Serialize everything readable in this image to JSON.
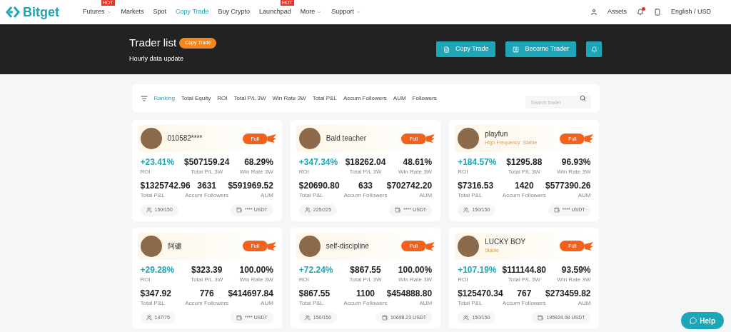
{
  "logo": {
    "text": "Bitget"
  },
  "nav": [
    {
      "label": "Futures",
      "selected": false,
      "badge": "HOT",
      "dropdown": true
    },
    {
      "label": "Markets",
      "selected": false,
      "dropdown": false
    },
    {
      "label": "Spot",
      "selected": false,
      "dropdown": false
    },
    {
      "label": "Copy Trade",
      "selected": true,
      "dropdown": false
    },
    {
      "label": "Buy Crypto",
      "selected": false,
      "dropdown": false
    },
    {
      "label": "Launchpad",
      "selected": false,
      "badge": "HOT",
      "dropdown": false
    },
    {
      "label": "More",
      "selected": false,
      "dropdown": true
    },
    {
      "label": "Support",
      "selected": false,
      "dropdown": true
    }
  ],
  "header_right": {
    "assets": "Assets",
    "notification_dot": true,
    "language": "English / USD"
  },
  "banner": {
    "title": "Trader list",
    "tag": "Copy Trade",
    "subtitle": "Hourly data update",
    "buttons": [
      "Copy Trade",
      "Become Trader"
    ]
  },
  "filters": [
    {
      "label": "Ranking",
      "selected": true
    },
    {
      "label": "Total Equity",
      "selected": false
    },
    {
      "label": "ROI",
      "selected": false
    },
    {
      "label": "Total P/L 3W",
      "selected": false
    },
    {
      "label": "Win Rate 3W",
      "selected": false
    },
    {
      "label": "Total P&L",
      "selected": false
    },
    {
      "label": "Accum Followers",
      "selected": false
    },
    {
      "label": "AUM",
      "selected": false
    },
    {
      "label": "Followers",
      "selected": false
    }
  ],
  "search": {
    "placeholder": "Search trader"
  },
  "traders": [
    {
      "name": "010582****",
      "status": "Full",
      "stats": [
        {
          "value": "+23.41%",
          "label": "ROI"
        },
        {
          "value": "$507159.24",
          "label": "Total P/L 3W"
        },
        {
          "value": "68.29%",
          "label": "Win Rate 3W"
        },
        {
          "value": "$1325742.96",
          "label": "Total P&L"
        },
        {
          "value": "3631",
          "label": "Accum Followers"
        },
        {
          "value": "$591969.52",
          "label": "AUM"
        }
      ],
      "followers": "150/150",
      "funds": "**** USDT"
    },
    {
      "name": "Bald teacher",
      "status": "Full",
      "stats": [
        {
          "value": "+347.34%",
          "label": "ROI"
        },
        {
          "value": "$18262.04",
          "label": "Total P/L 3W"
        },
        {
          "value": "48.61%",
          "label": "Win Rate 3W"
        },
        {
          "value": "$20690.80",
          "label": "Total P&L"
        },
        {
          "value": "633",
          "label": "Accum Followers"
        },
        {
          "value": "$702742.20",
          "label": "AUM"
        }
      ],
      "followers": "225/225",
      "funds": "**** USDT"
    },
    {
      "name": "playfun",
      "tags": "High Frequency  Stable",
      "status": "Full",
      "stats": [
        {
          "value": "+184.57%",
          "label": "ROI"
        },
        {
          "value": "$1295.88",
          "label": "Total P/L 3W"
        },
        {
          "value": "96.93%",
          "label": "Win Rate 3W"
        },
        {
          "value": "$7316.53",
          "label": "Total P&L"
        },
        {
          "value": "1420",
          "label": "Accum Followers"
        },
        {
          "value": "$577390.26",
          "label": "AUM"
        }
      ],
      "followers": "150/150",
      "funds": "**** USDT"
    },
    {
      "name": "阿镰",
      "status": "Full",
      "stats": [
        {
          "value": "+29.28%",
          "label": "ROI"
        },
        {
          "value": "$323.39",
          "label": "Total P/L 3W"
        },
        {
          "value": "100.00%",
          "label": "Win Rate 3W"
        },
        {
          "value": "$347.92",
          "label": "Total P&L"
        },
        {
          "value": "776",
          "label": "Accum Followers"
        },
        {
          "value": "$414697.84",
          "label": "AUM"
        }
      ],
      "followers": "147/75",
      "funds": "**** USDT"
    },
    {
      "name": "self-discipline",
      "status": "Full",
      "stats": [
        {
          "value": "+72.24%",
          "label": "ROI"
        },
        {
          "value": "$867.55",
          "label": "Total P/L 3W"
        },
        {
          "value": "100.00%",
          "label": "Win Rate 3W"
        },
        {
          "value": "$867.55",
          "label": "Total P&L"
        },
        {
          "value": "1100",
          "label": "Accum Followers"
        },
        {
          "value": "$454888.80",
          "label": "AUM"
        }
      ],
      "followers": "150/150",
      "funds": "10698.23 USDT"
    },
    {
      "name": "LUCKY BOY",
      "tags": "Stable",
      "status": "Full",
      "stats": [
        {
          "value": "+107.19%",
          "label": "ROI"
        },
        {
          "value": "$111144.80",
          "label": "Total P/L 3W"
        },
        {
          "value": "93.59%",
          "label": "Win Rate 3W"
        },
        {
          "value": "$125470.34",
          "label": "Total P&L"
        },
        {
          "value": "767",
          "label": "Accum Followers"
        },
        {
          "value": "$273459.82",
          "label": "AUM"
        }
      ],
      "followers": "150/150",
      "funds": "195924.08 USDT"
    }
  ],
  "help_button": "Help"
}
